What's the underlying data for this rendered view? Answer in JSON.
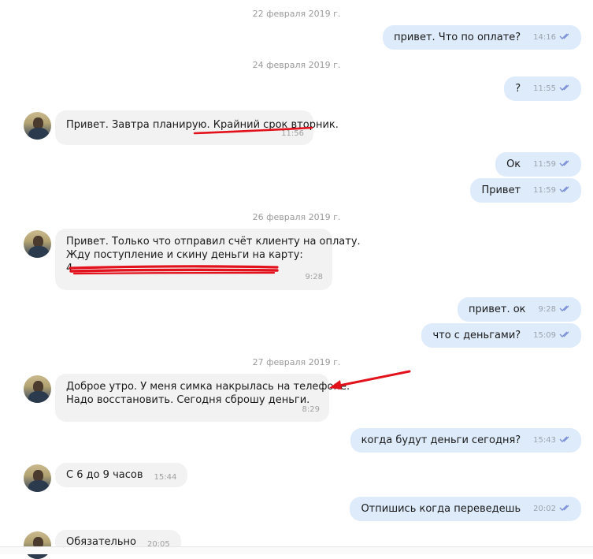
{
  "dates": {
    "d1": "22 февраля 2019 г.",
    "d2": "24 февраля 2019 г.",
    "d3": "26 февраля 2019 г.",
    "d4": "27 февраля 2019 г."
  },
  "messages": {
    "m1": {
      "text": "привет. Что по оплате?",
      "time": "14:16"
    },
    "m2": {
      "text": "?",
      "time": "11:55"
    },
    "m3": {
      "text": "Привет. Завтра планирую. ",
      "highlight": "Крайний срок вторник.",
      "time": "11:56"
    },
    "m4": {
      "text": "Ок",
      "time": "11:59"
    },
    "m5": {
      "text": "Привет",
      "time": "11:59"
    },
    "m6": {
      "line1": "Привет. Только что отправил счёт клиенту на оплату.",
      "line2": "Жду поступление и скину деньги на карту:",
      "line3_visible": "4",
      "time": "9:28"
    },
    "m7": {
      "text": "привет. ок",
      "time": "9:28"
    },
    "m8": {
      "text": "что с деньгами?",
      "time": "15:09"
    },
    "m9": {
      "line1": "Доброе утро. У меня симка накрылась на телефоне.",
      "line2": "Надо восстановить. Сегодня сброшу деньги.",
      "time": "8:29"
    },
    "m10": {
      "text": "когда будут деньги сегодня?",
      "time": "15:43"
    },
    "m11": {
      "text": "С 6 до 9 часов",
      "time": "15:44"
    },
    "m12": {
      "text": "Отпишись когда переведешь",
      "time": "20:02"
    },
    "m13": {
      "text": "Обязательно",
      "time": "20:05"
    }
  },
  "colors": {
    "incoming_bubble": "#f2f2f2",
    "outgoing_bubble": "#ddebfb",
    "read_ticks": "#7b8fd6",
    "annotation_red": "#e3111b"
  },
  "icons": {
    "read_status": "double-check-icon",
    "avatar": "contact-avatar"
  }
}
